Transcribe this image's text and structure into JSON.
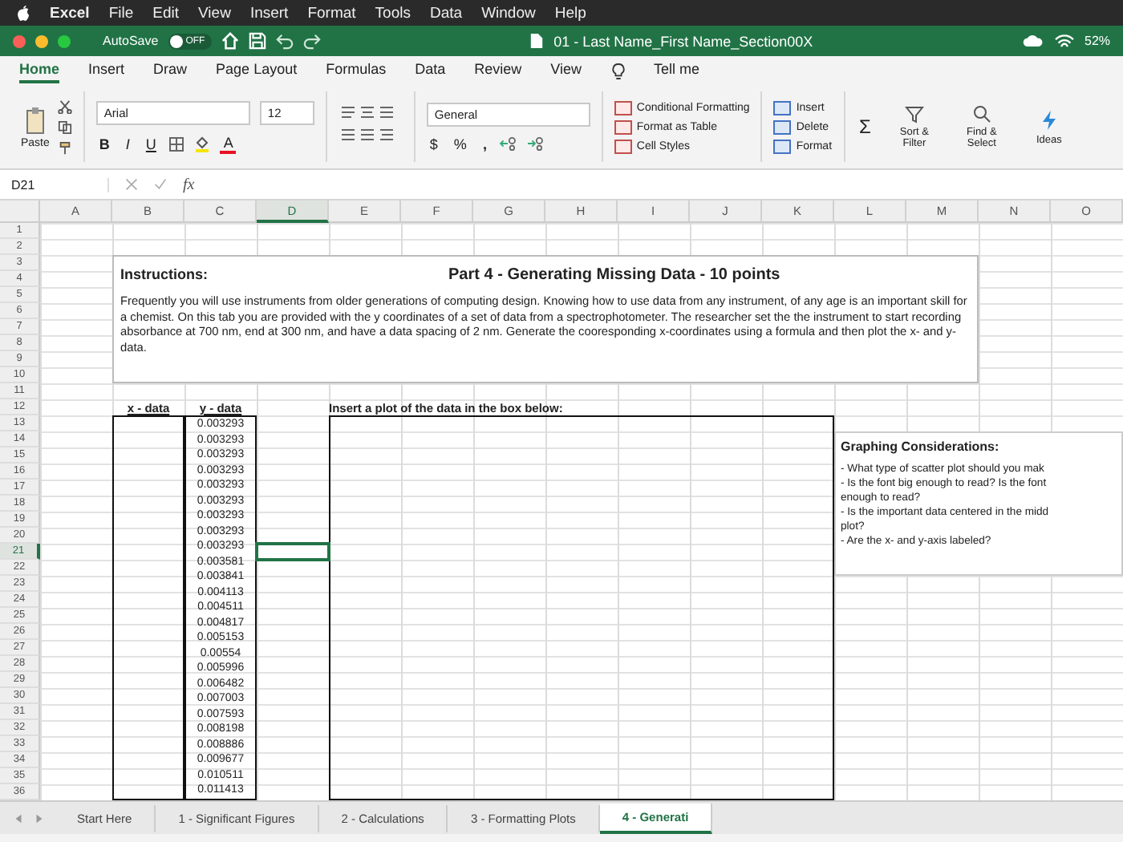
{
  "menu_bar": {
    "items": [
      "Excel",
      "File",
      "Edit",
      "View",
      "Insert",
      "Format",
      "Tools",
      "Data",
      "Window",
      "Help"
    ]
  },
  "title_bar": {
    "autosave_label": "AutoSave",
    "autosave_toggle": {
      "label": "OFF",
      "on": false
    },
    "document_title": "01 - Last Name_First Name_Section00X",
    "battery": "52%"
  },
  "ribbon_tabs": [
    {
      "label": "Home",
      "selected": true
    },
    {
      "label": "Insert",
      "selected": false
    },
    {
      "label": "Draw",
      "selected": false
    },
    {
      "label": "Page Layout",
      "selected": false
    },
    {
      "label": "Formulas",
      "selected": false
    },
    {
      "label": "Data",
      "selected": false
    },
    {
      "label": "Review",
      "selected": false
    },
    {
      "label": "View",
      "selected": false
    }
  ],
  "tell_me": "Tell me",
  "ribbon": {
    "paste": "Paste",
    "font": "Arial",
    "font_size": "12",
    "bold": "B",
    "italic": "I",
    "underline": "U",
    "font_color": "A",
    "number_format": "General",
    "currency": "$",
    "percent": "%",
    "comma": ",",
    "styles": [
      "Conditional Formatting",
      "Format as Table",
      "Cell Styles"
    ],
    "cells": [
      "Insert",
      "Delete",
      "Format"
    ],
    "sum": "Σ",
    "sort_filter": "Sort & Filter",
    "find_select": "Find & Select",
    "ideas": "Ideas"
  },
  "formula_bar": {
    "name_box": "D21",
    "fx": "fx"
  },
  "sheet": {
    "columns": [
      {
        "label": "A",
        "selected": false
      },
      {
        "label": "B",
        "selected": false
      },
      {
        "label": "C",
        "selected": false
      },
      {
        "label": "D",
        "selected": true
      },
      {
        "label": "E",
        "selected": false
      },
      {
        "label": "F",
        "selected": false
      },
      {
        "label": "G",
        "selected": false
      },
      {
        "label": "H",
        "selected": false
      },
      {
        "label": "I",
        "selected": false
      },
      {
        "label": "J",
        "selected": false
      },
      {
        "label": "K",
        "selected": false
      },
      {
        "label": "L",
        "selected": false
      },
      {
        "label": "M",
        "selected": false
      },
      {
        "label": "N",
        "selected": false
      },
      {
        "label": "O",
        "selected": false
      }
    ],
    "rows": [
      {
        "label": "1",
        "selected": false
      },
      {
        "label": "2",
        "selected": false
      },
      {
        "label": "3",
        "selected": false
      },
      {
        "label": "4",
        "selected": false
      },
      {
        "label": "5",
        "selected": false
      },
      {
        "label": "6",
        "selected": false
      },
      {
        "label": "7",
        "selected": false
      },
      {
        "label": "8",
        "selected": false
      },
      {
        "label": "9",
        "selected": false
      },
      {
        "label": "10",
        "selected": false
      },
      {
        "label": "11",
        "selected": false
      },
      {
        "label": "12",
        "selected": false
      },
      {
        "label": "13",
        "selected": false
      },
      {
        "label": "14",
        "selected": false
      },
      {
        "label": "15",
        "selected": false
      },
      {
        "label": "16",
        "selected": false
      },
      {
        "label": "17",
        "selected": false
      },
      {
        "label": "18",
        "selected": false
      },
      {
        "label": "19",
        "selected": false
      },
      {
        "label": "20",
        "selected": false
      },
      {
        "label": "21",
        "selected": true
      },
      {
        "label": "22",
        "selected": false
      },
      {
        "label": "23",
        "selected": false
      },
      {
        "label": "24",
        "selected": false
      },
      {
        "label": "25",
        "selected": false
      },
      {
        "label": "26",
        "selected": false
      },
      {
        "label": "27",
        "selected": false
      },
      {
        "label": "28",
        "selected": false
      },
      {
        "label": "29",
        "selected": false
      },
      {
        "label": "30",
        "selected": false
      },
      {
        "label": "31",
        "selected": false
      },
      {
        "label": "32",
        "selected": false
      },
      {
        "label": "33",
        "selected": false
      },
      {
        "label": "34",
        "selected": false
      },
      {
        "label": "35",
        "selected": false
      },
      {
        "label": "36",
        "selected": false
      }
    ],
    "instructions_heading": "Instructions:",
    "part_title": "Part 4 - Generating Missing Data - 10 points",
    "instructions": "Frequently you will use instruments from older generations of computing design. Knowing how to use data from any instrument, of any age is an important skill for a chemist. On this tab you are provided with the y coordinates of a set of data from a spectrophotometer.  The researcher set the the instrument to start recording absorbance at 700 nm, end at 300 nm, and have a data spacing of 2 nm. Generate the cooresponding x-coordinates using a formula and then plot the x- and y-data.",
    "x_header": "x - data",
    "y_header": "y - data",
    "y_values": [
      "0.003293",
      "0.003293",
      "0.003293",
      "0.003293",
      "0.003293",
      "0.003293",
      "0.003293",
      "0.003293",
      "0.003293",
      "0.003581",
      "0.003841",
      "0.004113",
      "0.004511",
      "0.004817",
      "0.005153",
      "0.00554",
      "0.005996",
      "0.006482",
      "0.007003",
      "0.007593",
      "0.008198",
      "0.008886",
      "0.009677",
      "0.010511",
      "0.011413"
    ],
    "plot_prompt": "Insert a plot of the data in the box below:",
    "considerations_heading": "Graphing Considerations:",
    "considerations_lines": [
      "- What type of scatter plot should you mak",
      "- Is the font big enough to read? Is the font",
      "enough to read?",
      "- Is the important data centered in the midd",
      "plot?",
      "- Are the x- and y-axis labeled?"
    ]
  },
  "sheet_tabs": [
    {
      "label": "Start Here",
      "selected": false
    },
    {
      "label": "1 - Significant Figures",
      "selected": false
    },
    {
      "label": "2 - Calculations",
      "selected": false
    },
    {
      "label": "3 - Formatting Plots",
      "selected": false
    },
    {
      "label": "4 - Generati",
      "selected": true
    }
  ]
}
